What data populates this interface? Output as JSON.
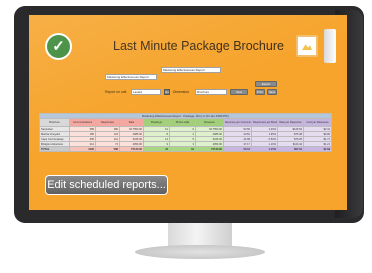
{
  "app": {
    "title": "Last Minute Package Brochure",
    "theme_color": "#f6a42c"
  },
  "icons": {
    "status": "check-icon",
    "image": "image-icon",
    "tab": "tab-icon"
  },
  "check_glyph": "✓",
  "controls": {
    "report_select": "Marketing Effectiveness Report",
    "report_name": "Marketing Effectiveness Report",
    "report_on_label": "Report on unit",
    "report_on_value": "Lasted",
    "go_label": "Go",
    "dimension_label": "Dimension",
    "dimension_value": "Brochure",
    "view_label": "View",
    "export_label": "Export",
    "print_label": "Print",
    "save_label": "Save"
  },
  "table": {
    "title": "Marketing Effectiveness Report - Package, All by 2 (23 Jan 2008 RTF)",
    "headers": [
      "Brochure",
      "Communications",
      "Responses",
      "Rate",
      "Bookings",
      "Phone calls",
      "Revenue",
      "Revenue per Communication",
      "Responses per Booking",
      "Rate per Response",
      "Cost per Response"
    ],
    "rows": [
      [
        "Nantucket",
        "385",
        "180",
        "46.7550.00",
        "12",
        "6",
        "46.7550.00",
        "52.56",
        "1.00%",
        "$129.54",
        "$2.41"
      ],
      [
        "Martha Vineyard",
        "186",
        "123",
        "4085.00",
        "8",
        "2",
        "4085.00",
        "23.81",
        "1.95%",
        "$76.48",
        "$0.90"
      ],
      [
        "Cape Cod Getaway",
        "305",
        "211",
        "3345.00",
        "14",
        "5",
        "3345.00",
        "41.89",
        "0.50%",
        "$75.25",
        "$1.71"
      ],
      [
        "Bridgton Adventure",
        "214",
        "74",
        "2950.00",
        "9",
        "3",
        "2950.00",
        "37.17",
        "1.16%",
        "$116.44",
        "$1.21"
      ]
    ],
    "total": [
      "TOTAL",
      "1090",
      "588",
      "57130.00",
      "43",
      "16",
      "57130.00",
      "50.12",
      "1.15%",
      "$97.16",
      "$1.63"
    ]
  },
  "buttons": {
    "edit_scheduled": "Edit scheduled reports..."
  }
}
